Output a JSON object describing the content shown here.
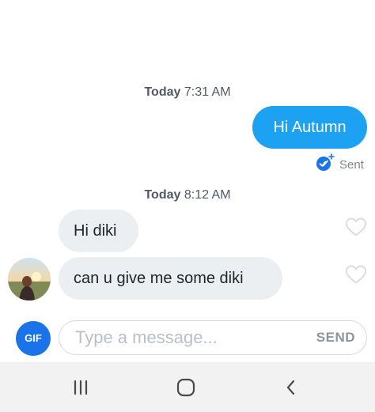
{
  "conversation": {
    "timestamps": [
      {
        "day": "Today",
        "time": "7:31 AM"
      },
      {
        "day": "Today",
        "time": "8:12 AM"
      }
    ],
    "outgoing": [
      {
        "text": "Hi Autumn",
        "status": "Sent"
      }
    ],
    "incoming": [
      {
        "text": "Hi diki"
      },
      {
        "text": "can u give me some diki"
      }
    ]
  },
  "composer": {
    "gif_label": "GIF",
    "placeholder": "Type a message...",
    "send_label": "SEND"
  },
  "icons": {
    "sent_status": "check-badge-icon",
    "like": "heart-outline-icon",
    "recents": "recent-apps-icon",
    "home": "home-icon",
    "back": "back-icon"
  },
  "colors": {
    "outgoing_bubble": "#1da1f2",
    "incoming_bubble": "#eceff2",
    "gif_button": "#1a73e8",
    "sent_check": "#1a73e8",
    "nav_bar": "#f2f2f2"
  }
}
